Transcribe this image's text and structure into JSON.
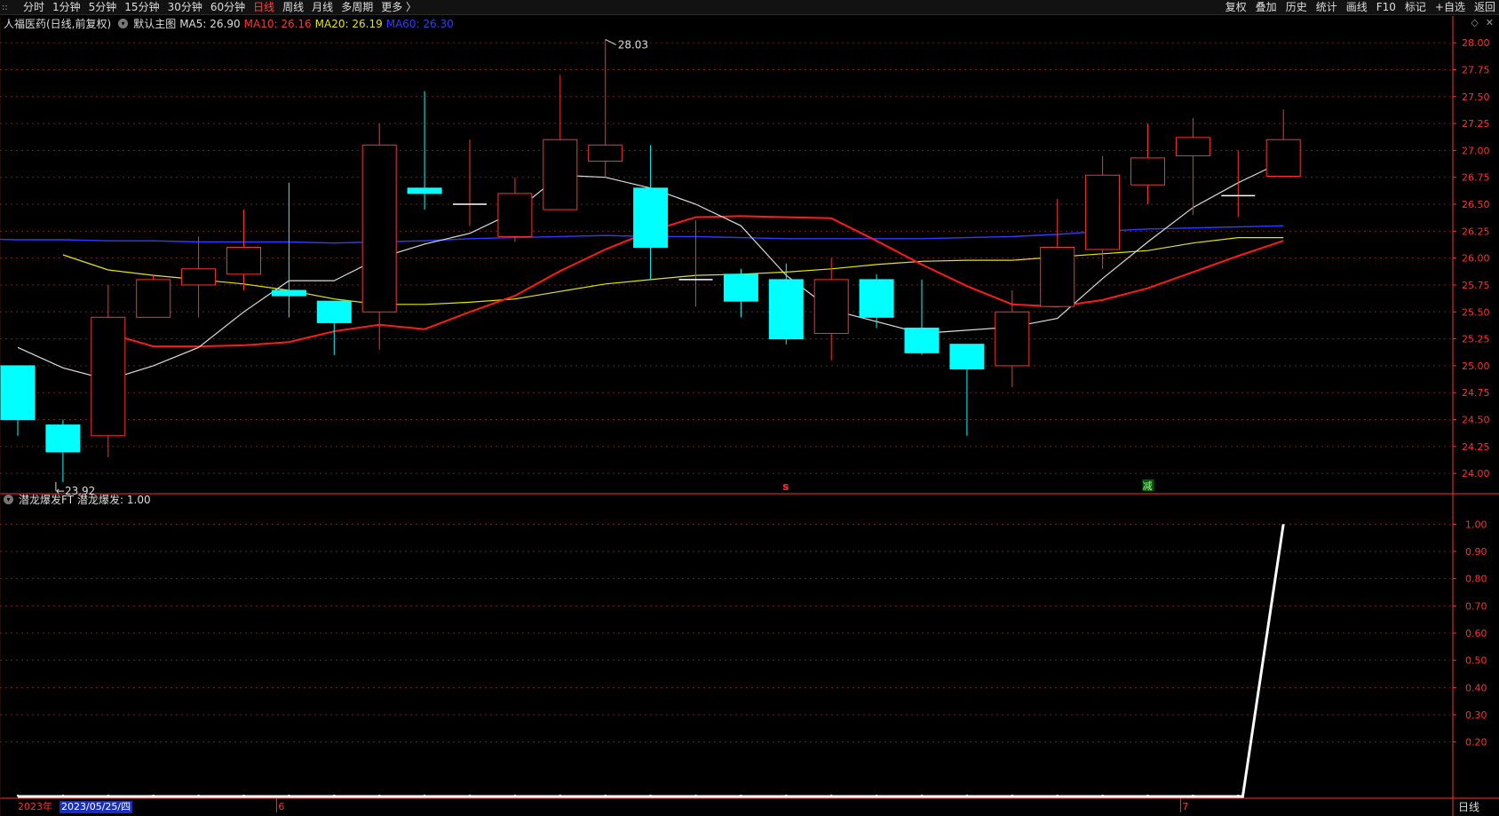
{
  "toolbar": {
    "logo": "::",
    "periods": [
      "分时",
      "1分钟",
      "5分钟",
      "15分钟",
      "30分钟",
      "60分钟",
      "日线",
      "周线",
      "月线",
      "多周期",
      "更多 〉"
    ],
    "active_period": "日线",
    "tools": [
      "复权",
      "叠加",
      "历史",
      "统计",
      "画线",
      "F10",
      "标记",
      "+自选",
      "返回"
    ]
  },
  "main_info": {
    "symbol": "人福医药(日线,前复权)",
    "template": "默认主图",
    "ma5": "MA5: 26.90",
    "ma10": "MA10: 26.16",
    "ma20": "MA20: 26.19",
    "ma60": "MA60: 26.30"
  },
  "top_right_icons": [
    "diamond-icon",
    "close-icon"
  ],
  "sub_info": {
    "indicator": "潜龙爆发FT",
    "value": "潜龙爆发: 1.00"
  },
  "colors": {
    "up": "#ff3030",
    "down": "#00ffff",
    "ma5": "#dddddd",
    "ma10": "#ff1a1a",
    "ma20": "#e6e600",
    "ma60": "#2f3cff",
    "axis": "#ff3030",
    "grid": "#7a1e1e"
  },
  "chart_data": [
    {
      "type": "candlestick",
      "y_range": [
        23.82,
        28.1
      ],
      "y_ticks": [
        "28.00",
        "27.75",
        "27.50",
        "27.25",
        "27.00",
        "26.75",
        "26.50",
        "26.25",
        "26.00",
        "25.75",
        "25.50",
        "25.25",
        "25.00",
        "24.75",
        "24.50",
        "24.25",
        "24.00"
      ],
      "candles": [
        {
          "o": 25.0,
          "h": 25.0,
          "l": 24.35,
          "c": 24.5
        },
        {
          "o": 24.45,
          "h": 24.5,
          "l": 23.92,
          "c": 24.2
        },
        {
          "o": 24.35,
          "h": 25.75,
          "l": 24.15,
          "c": 25.45
        },
        {
          "o": 25.45,
          "h": 25.85,
          "l": 25.45,
          "c": 25.8
        },
        {
          "o": 25.75,
          "h": 26.2,
          "l": 25.45,
          "c": 25.9
        },
        {
          "o": 25.85,
          "h": 26.45,
          "l": 25.7,
          "c": 26.1
        },
        {
          "o": 25.7,
          "h": 26.7,
          "l": 25.45,
          "c": 25.65
        },
        {
          "o": 25.6,
          "h": 25.6,
          "l": 25.1,
          "c": 25.4
        },
        {
          "o": 25.5,
          "h": 27.25,
          "l": 25.15,
          "c": 27.05
        },
        {
          "o": 26.65,
          "h": 27.55,
          "l": 26.45,
          "c": 26.6
        },
        {
          "o": 26.5,
          "h": 27.1,
          "l": 26.3,
          "c": 26.5
        },
        {
          "o": 26.2,
          "h": 26.75,
          "l": 26.15,
          "c": 26.6
        },
        {
          "o": 26.45,
          "h": 27.7,
          "l": 26.45,
          "c": 27.1
        },
        {
          "o": 26.9,
          "h": 28.03,
          "l": 26.75,
          "c": 27.05
        },
        {
          "o": 26.65,
          "h": 27.05,
          "l": 25.8,
          "c": 26.1
        },
        {
          "o": 25.8,
          "h": 26.35,
          "l": 25.55,
          "c": 25.8
        },
        {
          "o": 25.85,
          "h": 25.9,
          "l": 25.45,
          "c": 25.6
        },
        {
          "o": 25.8,
          "h": 25.95,
          "l": 25.2,
          "c": 25.25
        },
        {
          "o": 25.3,
          "h": 26.0,
          "l": 25.05,
          "c": 25.8
        },
        {
          "o": 25.8,
          "h": 25.85,
          "l": 25.35,
          "c": 25.45
        },
        {
          "o": 25.35,
          "h": 25.8,
          "l": 25.1,
          "c": 25.12
        },
        {
          "o": 25.2,
          "h": 25.2,
          "l": 24.35,
          "c": 24.97
        },
        {
          "o": 25.0,
          "h": 25.7,
          "l": 24.8,
          "c": 25.5
        },
        {
          "o": 25.55,
          "h": 26.55,
          "l": 25.55,
          "c": 26.1
        },
        {
          "o": 26.08,
          "h": 26.95,
          "l": 25.9,
          "c": 26.77
        },
        {
          "o": 26.68,
          "h": 27.25,
          "l": 26.5,
          "c": 26.93
        },
        {
          "o": 26.95,
          "h": 27.3,
          "l": 26.4,
          "c": 27.12
        },
        {
          "o": 26.58,
          "h": 27.0,
          "l": 26.38,
          "c": 26.58
        },
        {
          "o": 26.76,
          "h": 27.38,
          "l": 26.76,
          "c": 27.1
        }
      ],
      "ma5": [
        25.17,
        24.98,
        24.87,
        25.0,
        25.17,
        25.5,
        25.79,
        25.79,
        26.0,
        26.13,
        26.23,
        26.43,
        26.77,
        26.75,
        26.65,
        26.5,
        26.3,
        25.84,
        25.52,
        25.41,
        25.3,
        25.33,
        25.36,
        25.44,
        25.81,
        26.15,
        26.47,
        26.7,
        26.9
      ],
      "ma10": [
        25.3,
        25.18,
        25.18,
        25.19,
        25.22,
        25.32,
        25.38,
        25.34,
        25.5,
        25.65,
        25.88,
        26.08,
        26.25,
        26.38,
        26.39,
        26.38,
        26.37,
        26.16,
        25.94,
        25.74,
        25.57,
        25.55,
        25.61,
        25.72,
        25.87,
        26.02,
        26.16
      ],
      "ma20": [
        26.03,
        25.89,
        25.84,
        25.8,
        25.76,
        25.7,
        25.62,
        25.57,
        25.57,
        25.59,
        25.62,
        25.69,
        25.76,
        25.8,
        25.84,
        25.85,
        25.87,
        25.9,
        25.94,
        25.97,
        25.98,
        25.98,
        26.01,
        26.04,
        26.07,
        26.14,
        26.19,
        26.19
      ],
      "ma60": [
        26.18,
        26.17,
        26.17,
        26.16,
        26.16,
        26.15,
        26.15,
        26.15,
        26.14,
        26.15,
        26.16,
        26.18,
        26.19,
        26.2,
        26.21,
        26.2,
        26.2,
        26.19,
        26.18,
        26.18,
        26.18,
        26.18,
        26.19,
        26.2,
        26.22,
        26.25,
        26.27,
        26.28,
        26.29,
        26.3
      ],
      "annotations": {
        "high_label": "28.03",
        "low_label": "23.92",
        "signal_s": "s",
        "signal_jian": "减"
      }
    },
    {
      "type": "line",
      "indicator": "潜龙爆发",
      "y_range": [
        0,
        1.05
      ],
      "y_ticks": [
        "1.00",
        "0.90",
        "0.80",
        "0.70",
        "0.60",
        "0.50",
        "0.40",
        "0.30",
        "0.20"
      ],
      "values": [
        0,
        0,
        0,
        0,
        0,
        0,
        0,
        0,
        0,
        0,
        0,
        0,
        0,
        0,
        0,
        0,
        0,
        0,
        0,
        0,
        0,
        0,
        0,
        0,
        0,
        0,
        0,
        0,
        1.0
      ]
    }
  ],
  "x_axis": {
    "year_label": "2023年",
    "selected_date": "2023/05/25/四",
    "month_6": "6",
    "month_7": "7"
  },
  "bottom_period": "日线"
}
